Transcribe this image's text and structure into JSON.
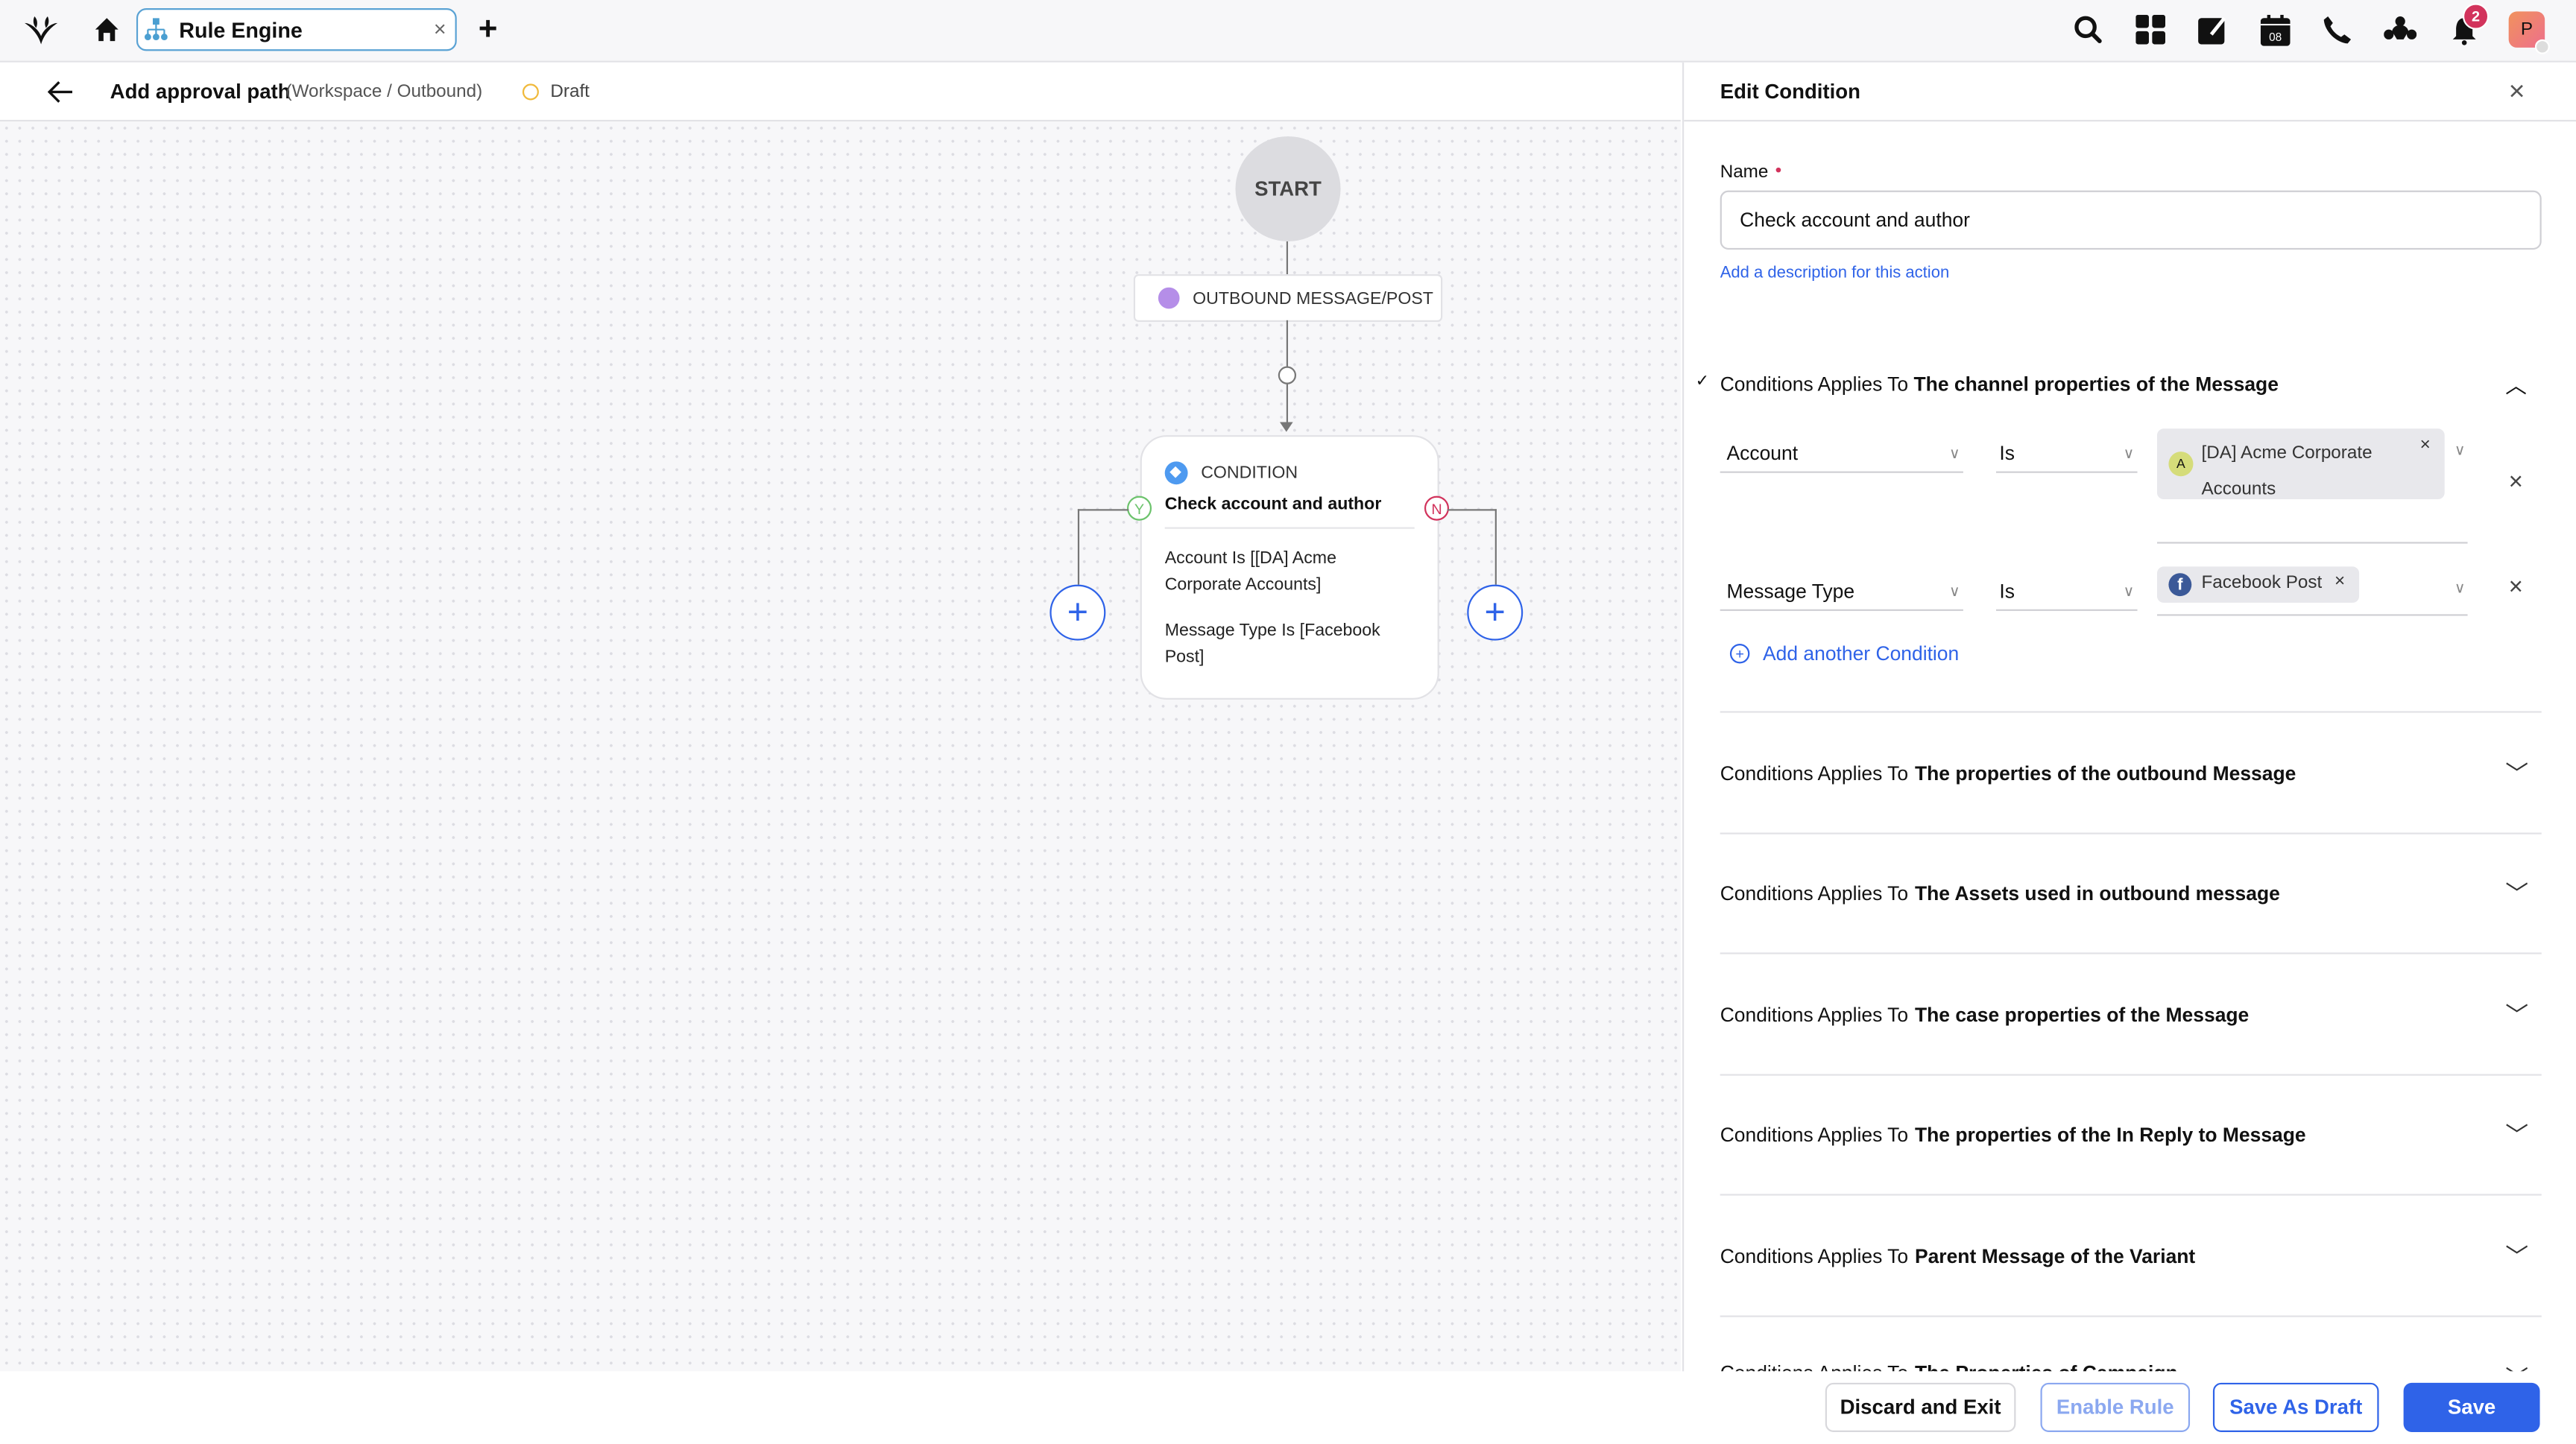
{
  "topbar": {
    "tab_label": "Rule Engine",
    "notification_count": "2",
    "avatar_initial": "P",
    "icons": [
      "logo-icon",
      "home-icon",
      "search-icon",
      "apps-grid-icon",
      "compose-icon",
      "calendar-icon",
      "phone-icon",
      "community-icon",
      "bell-icon"
    ],
    "calendar_day": "08"
  },
  "header": {
    "title": "Add approval path",
    "context": "(Workspace / Outbound)",
    "status": "Draft",
    "status_color": "#f0b93a"
  },
  "flow": {
    "start": "START",
    "trigger": "OUTBOUND MESSAGE/POST",
    "condition": {
      "type": "CONDITION",
      "name": "Check account and author",
      "lines": [
        "Account Is [[DA] Acme Corporate Accounts]",
        "Message Type Is [Facebook Post]"
      ],
      "yes": "Y",
      "no": "N"
    }
  },
  "panel": {
    "title": "Edit Condition",
    "name_label": "Name",
    "name_value": "Check account and author",
    "description_link": "Add a description for this action",
    "applies_prefix": "Conditions Applies To",
    "expanded_section": "The channel properties of the Message",
    "rows": [
      {
        "field": "Account",
        "operator": "Is",
        "value": "[DA] Acme Corporate Accounts",
        "value_avatar": "A"
      },
      {
        "field": "Message Type",
        "operator": "Is",
        "value": "Facebook Post"
      }
    ],
    "add_condition": "Add another Condition",
    "sections": [
      "The properties of the outbound Message",
      "The Assets used in outbound message",
      "The case properties of the Message",
      "The properties of the In Reply to Message",
      "Parent Message of the Variant",
      "The Properties of Campaign"
    ]
  },
  "footer": {
    "discard": "Discard and Exit",
    "enable": "Enable Rule",
    "draft": "Save As Draft",
    "save": "Save"
  },
  "colors": {
    "accent": "#2f63e8",
    "yes": "#6cc36c",
    "no": "#d2335c"
  }
}
